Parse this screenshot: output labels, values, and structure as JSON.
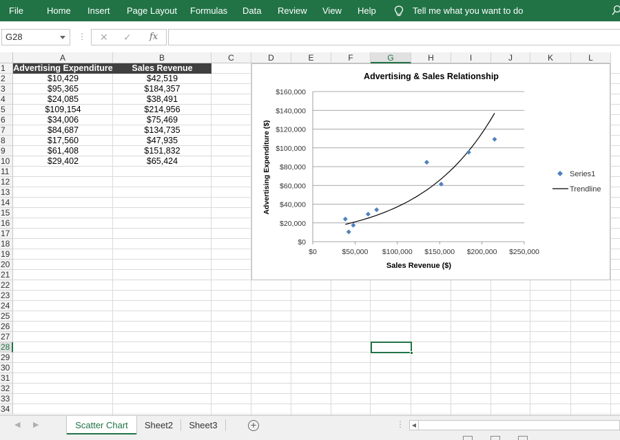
{
  "ribbon": {
    "tabs": [
      "File",
      "Home",
      "Insert",
      "Page Layout",
      "Formulas",
      "Data",
      "Review",
      "View",
      "Help"
    ],
    "tell_me": "Tell me what you want to do"
  },
  "formula_bar": {
    "name_box": "G28",
    "fx_label": "fx",
    "formula": ""
  },
  "columns": [
    "A",
    "B",
    "C",
    "D",
    "E",
    "F",
    "G",
    "H",
    "I",
    "J",
    "K",
    "L"
  ],
  "selected_column": "G",
  "selected_row": 28,
  "row_count": 34,
  "sheet": {
    "headers": [
      "Advertising Expenditure",
      "Sales Revenue"
    ],
    "rows": [
      [
        "$10,429",
        "$42,519"
      ],
      [
        "$95,365",
        "$184,357"
      ],
      [
        "$24,085",
        "$38,491"
      ],
      [
        "$109,154",
        "$214,956"
      ],
      [
        "$34,006",
        "$75,469"
      ],
      [
        "$84,687",
        "$134,735"
      ],
      [
        "$17,560",
        "$47,935"
      ],
      [
        "$61,408",
        "$151,832"
      ],
      [
        "$29,402",
        "$65,424"
      ]
    ]
  },
  "chart_data": {
    "type": "scatter",
    "title": "Advertising & Sales Relationship",
    "xlabel": "Sales Revenue ($)",
    "ylabel": "Advertising Expenditure ($)",
    "xlim": [
      0,
      250000
    ],
    "ylim": [
      0,
      160000
    ],
    "x_ticks": [
      0,
      50000,
      100000,
      150000,
      200000,
      250000
    ],
    "x_tick_labels": [
      "$0",
      "$50,000",
      "$100,000",
      "$150,000",
      "$200,000",
      "$250,000"
    ],
    "y_ticks": [
      0,
      20000,
      40000,
      60000,
      80000,
      100000,
      120000,
      140000,
      160000
    ],
    "y_tick_labels": [
      "$0",
      "$20,000",
      "$40,000",
      "$60,000",
      "$80,000",
      "$100,000",
      "$120,000",
      "$140,000",
      "$160,000"
    ],
    "grid": "horizontal",
    "legend_position": "right",
    "series": [
      {
        "name": "Series1",
        "color": "#4f81bd",
        "marker": "diamond",
        "points": [
          [
            42519,
            10429
          ],
          [
            184357,
            95365
          ],
          [
            38491,
            24085
          ],
          [
            214956,
            109154
          ],
          [
            75469,
            34006
          ],
          [
            134735,
            84687
          ],
          [
            47935,
            17560
          ],
          [
            151832,
            61408
          ],
          [
            65424,
            29402
          ]
        ]
      }
    ],
    "trendline": {
      "name": "Trendline",
      "type": "exponential",
      "color": "#000000",
      "x_range": [
        38491,
        214956
      ],
      "y_range": [
        18500,
        137000
      ]
    }
  },
  "sheet_tabs": [
    "Scatter Chart",
    "Sheet2",
    "Sheet3"
  ],
  "active_tab": "Scatter Chart"
}
